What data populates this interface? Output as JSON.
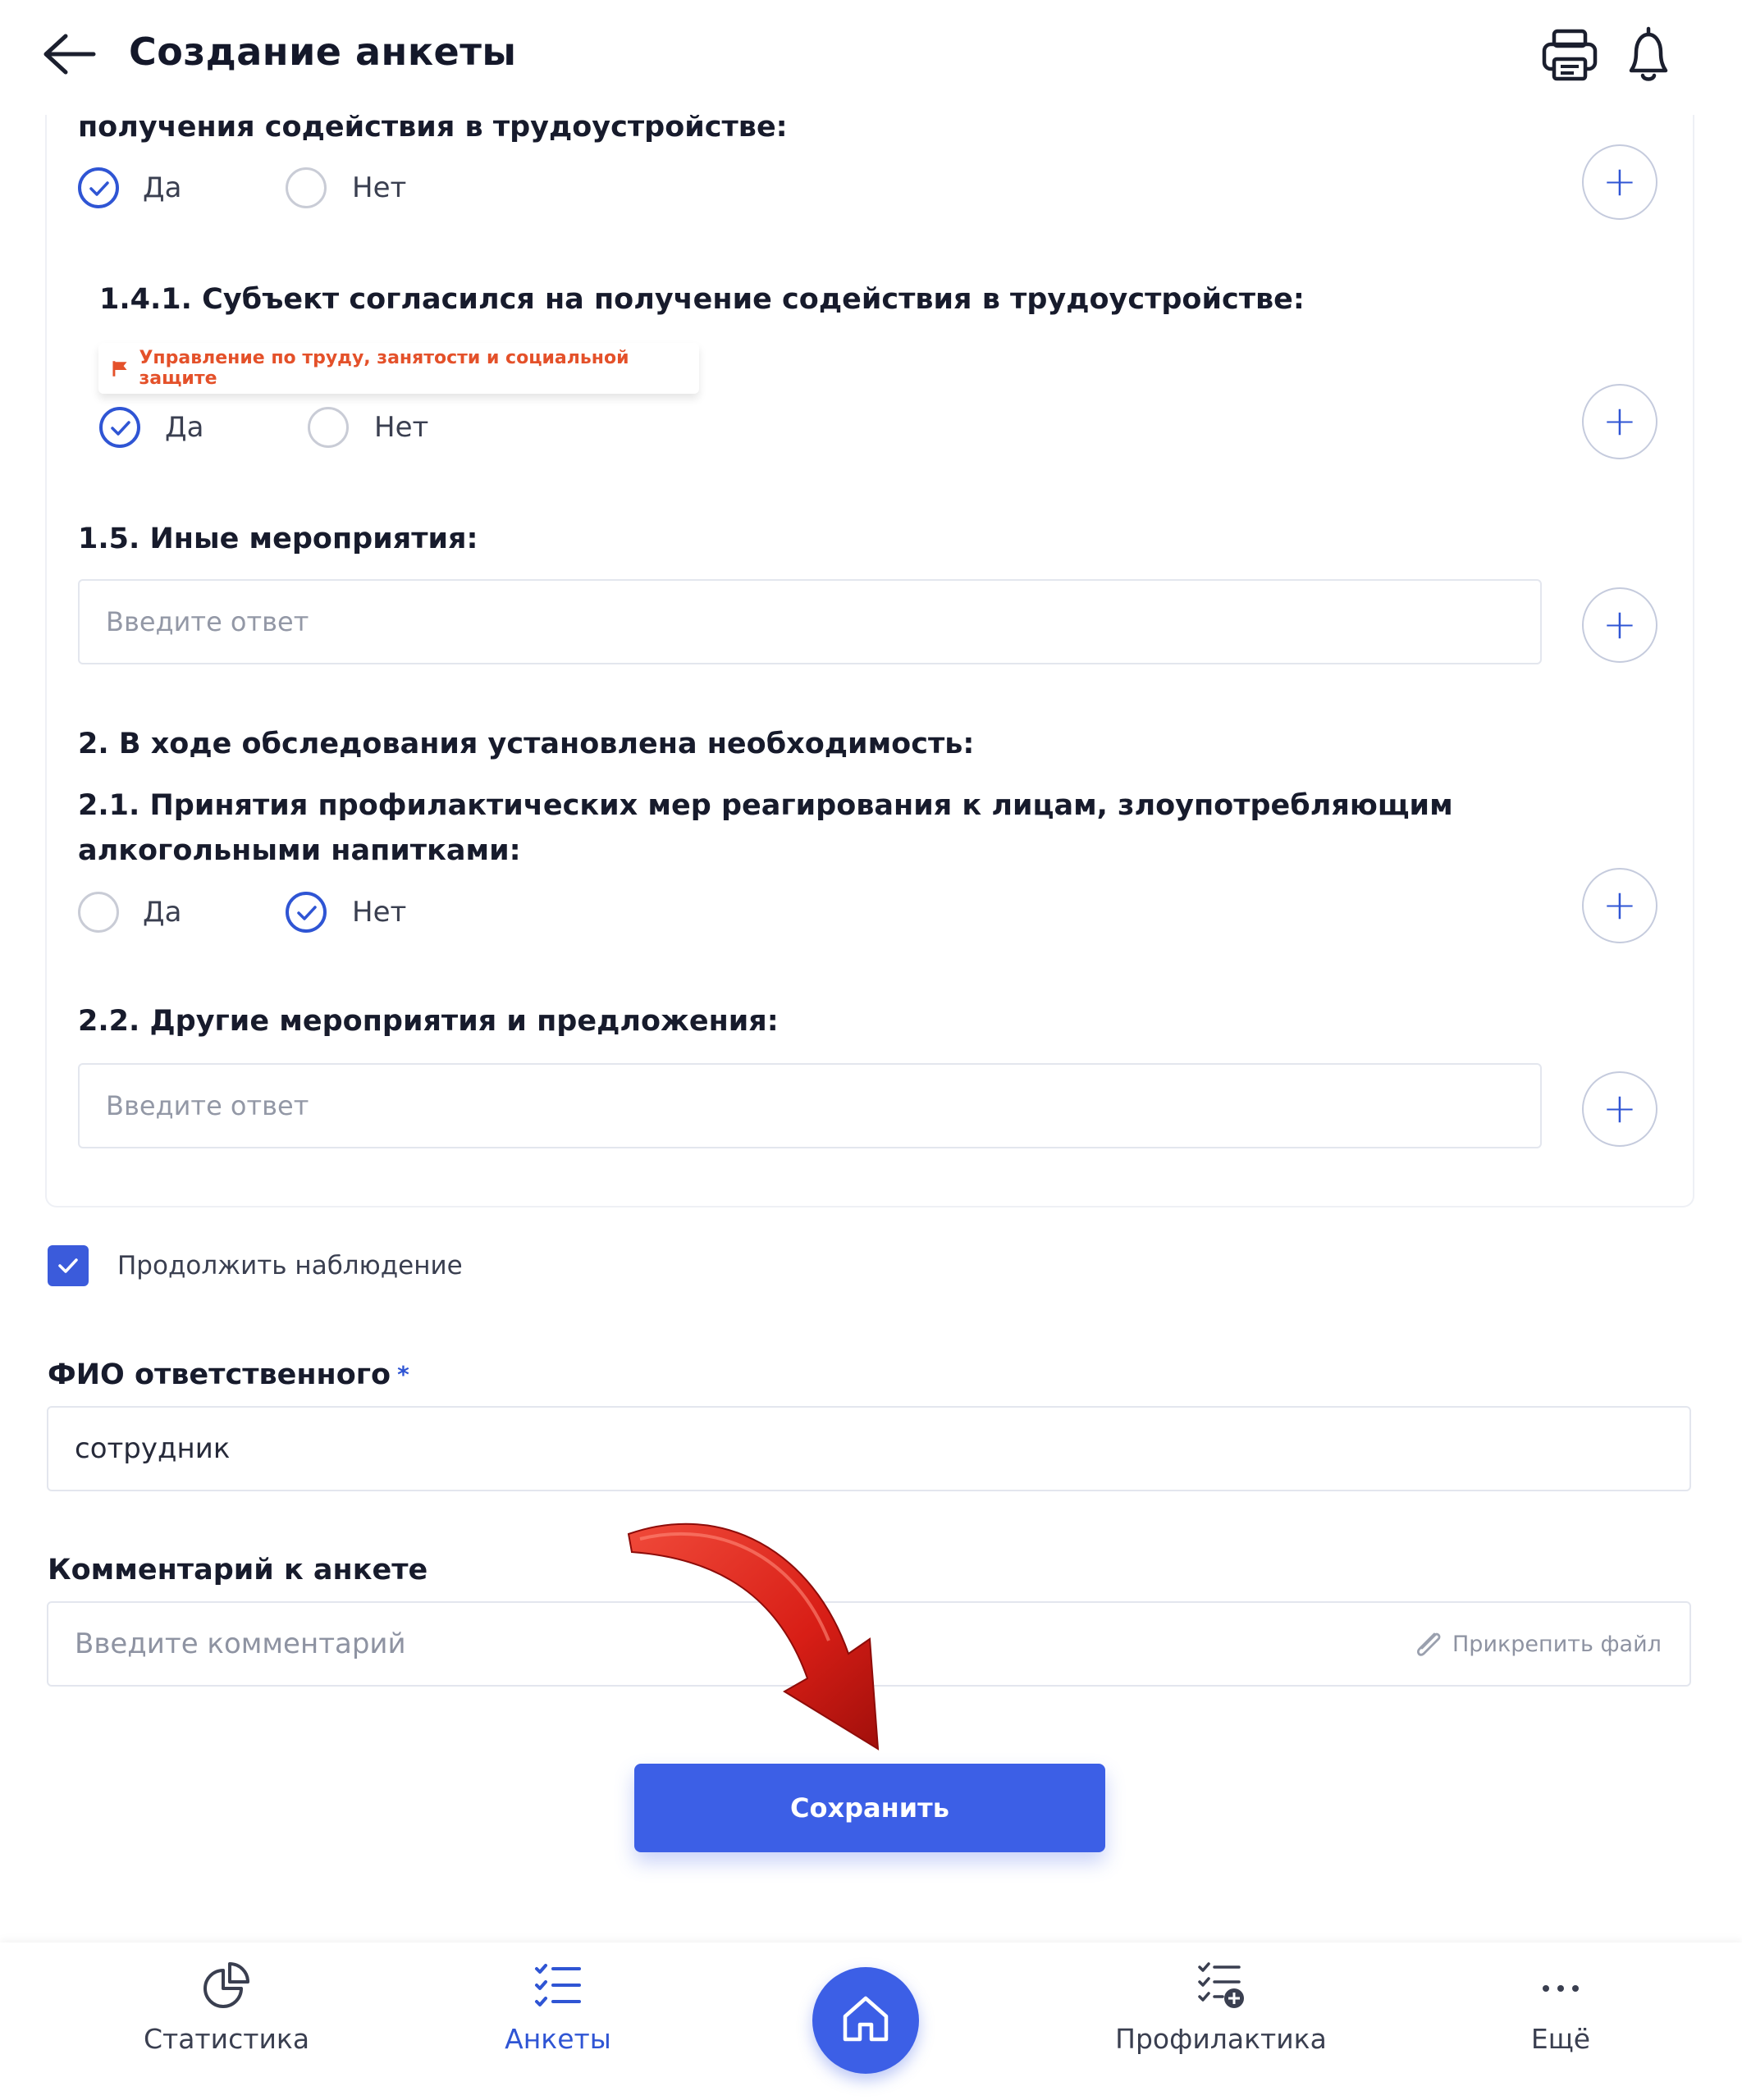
{
  "header": {
    "title": "Создание анкеты"
  },
  "questions": {
    "q14": {
      "label": "получения содействия в трудоустройстве:",
      "yes": "Да",
      "no": "Нет",
      "selected": "yes"
    },
    "q141": {
      "label": "1.4.1. Субъект согласился на получение содействия в трудоустройстве:",
      "department": "Управление по труду, занятости и социальной защите",
      "yes": "Да",
      "no": "Нет",
      "selected": "yes"
    },
    "q15": {
      "label": "1.5. Иные мероприятия:",
      "placeholder": "Введите ответ"
    },
    "q2": {
      "label": "2. В ходе обследования установлена необходимость:"
    },
    "q21": {
      "label_line1": "2.1. Принятия профилактических мер реагирования к лицам, злоупотребляющим",
      "label_line2": "алкогольными напитками:",
      "yes": "Да",
      "no": "Нет",
      "selected": "no"
    },
    "q22": {
      "label": "2.2. Другие мероприятия и предложения:",
      "placeholder": "Введите ответ"
    }
  },
  "continue_observation": {
    "label": "Продолжить наблюдение",
    "checked": true
  },
  "responsible": {
    "label": "ФИО ответственного",
    "required_mark": "*",
    "value": "сотрудник"
  },
  "comment": {
    "label": "Комментарий к анкете",
    "placeholder": "Введите комментарий",
    "attach_label": "Прикрепить файл"
  },
  "save_label": "Сохранить",
  "bottom_nav": {
    "items": [
      {
        "label": "Статистика",
        "icon": "pie-chart-icon"
      },
      {
        "label": "Анкеты",
        "icon": "checklist-icon",
        "active": true
      },
      {
        "label": "Профилактика",
        "icon": "checklist-add-icon"
      },
      {
        "label": "Ещё",
        "icon": "more-dots-icon"
      }
    ],
    "home_icon": "home-icon"
  },
  "colors": {
    "accent": "#3c5fe6",
    "department_tag": "#e4512a",
    "annotation_arrow": "#d9241c"
  }
}
